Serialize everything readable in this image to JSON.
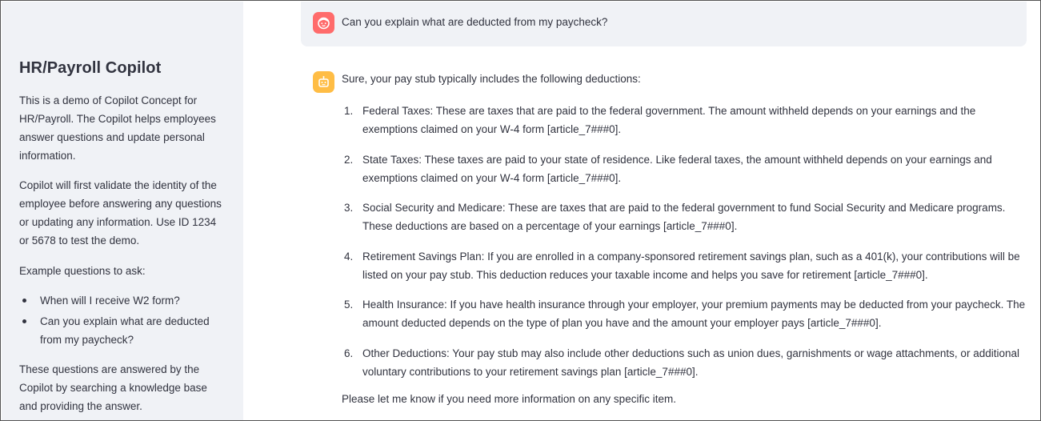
{
  "sidebar": {
    "title": "HR/Payroll Copilot",
    "description": "This is a demo of Copilot Concept for HR/Payroll. The Copilot helps employees answer questions and update personal information.",
    "validation_note": "Copilot will first validate the identity of the employee before answering any questions or updating any information. Use ID 1234 or 5678 to test the demo.",
    "examples_heading": "Example questions to ask:",
    "examples": [
      "When will I receive W2 form?",
      "Can you explain what are deducted from my paycheck?"
    ],
    "footer_note": "These questions are answered by the Copilot by searching a knowledge base and providing the answer."
  },
  "chat": {
    "user_message": "Can you explain what are deducted from my paycheck?",
    "assistant": {
      "intro": "Sure, your pay stub typically includes the following deductions:",
      "items": [
        {
          "num": "1.",
          "text": "Federal Taxes: These are taxes that are paid to the federal government. The amount withheld depends on your earnings and the exemptions claimed on your W-4 form [article_7###0]."
        },
        {
          "num": "2.",
          "text": "State Taxes: These taxes are paid to your state of residence. Like federal taxes, the amount withheld depends on your earnings and exemptions claimed on your W-4 form [article_7###0]."
        },
        {
          "num": "3.",
          "text": "Social Security and Medicare: These are taxes that are paid to the federal government to fund Social Security and Medicare programs. These deductions are based on a percentage of your earnings [article_7###0]."
        },
        {
          "num": "4.",
          "text": "Retirement Savings Plan: If you are enrolled in a company-sponsored retirement savings plan, such as a 401(k), your contributions will be listed on your pay stub. This deduction reduces your taxable income and helps you save for retirement [article_7###0]."
        },
        {
          "num": "5.",
          "text": "Health Insurance: If you have health insurance through your employer, your premium payments may be deducted from your paycheck. The amount deducted depends on the type of plan you have and the amount your employer pays [article_7###0]."
        },
        {
          "num": "6.",
          "text": "Other Deductions: Your pay stub may also include other deductions such as union dues, garnishments or wage attachments, or additional voluntary contributions to your retirement savings plan [article_7###0]."
        }
      ],
      "outro": "Please let me know if you need more information on any specific item."
    }
  },
  "icons": {
    "user_avatar": "user-face-icon",
    "assistant_avatar": "robot-icon"
  },
  "colors": {
    "sidebar_bg": "#f0f2f6",
    "user_avatar": "#ff6b6b",
    "assistant_avatar": "#ffbd45",
    "text": "#31333f"
  }
}
